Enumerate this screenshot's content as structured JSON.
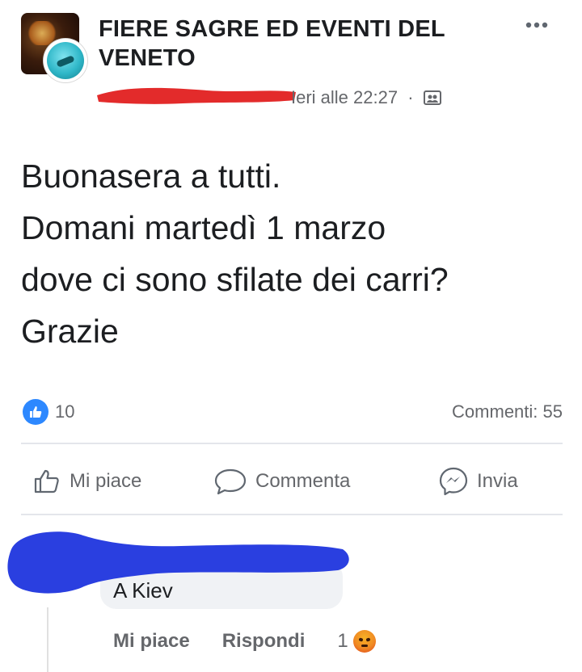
{
  "post": {
    "group_name": "FIERE SAGRE ED EVENTI DEL VENETO",
    "timestamp": "Ieri alle 22:27",
    "meta_separator": "·",
    "more_icon": "more-horizontal-icon",
    "audience_icon": "group-audience-icon",
    "body_lines": [
      "Buonasera a tutti.",
      "Domani martedì 1 marzo",
      "dove ci sono sfilate dei carri?",
      "Grazie"
    ],
    "like_count": "10",
    "comments_label": "Commenti: 55"
  },
  "actions": {
    "like": "Mi piace",
    "comment": "Commenta",
    "share": "Invia"
  },
  "comment": {
    "text": "A Kiev",
    "like_label": "Mi piace",
    "reply_label": "Rispondi",
    "reaction_count": "1"
  },
  "colors": {
    "like_blue": "#2d88ff",
    "redaction_red": "#e32b2b",
    "redaction_blue": "#2a3fe0",
    "muted_text": "#65676b"
  }
}
